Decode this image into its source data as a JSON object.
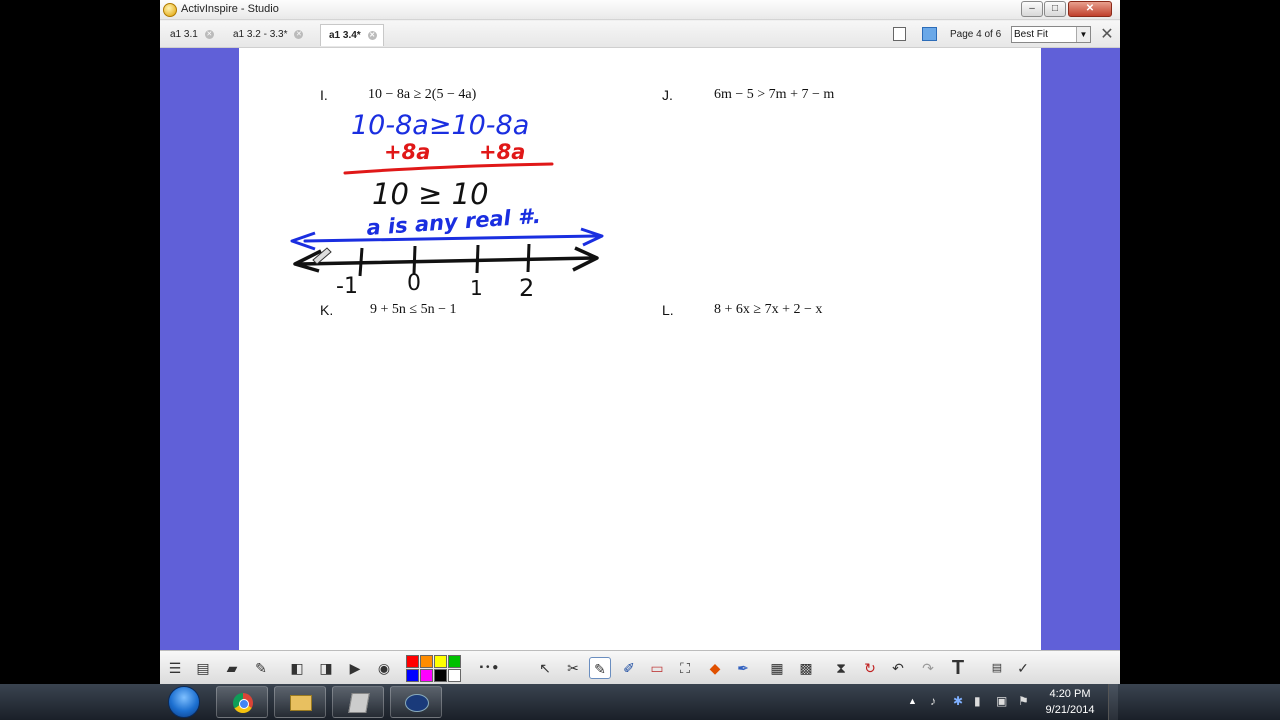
{
  "window": {
    "title": "ActivInspire - Studio",
    "minimize": "–",
    "maximize": "□",
    "close": "✕"
  },
  "tabs": [
    {
      "label": "a1 3.1"
    },
    {
      "label": "a1 3.2 - 3.3*"
    },
    {
      "label": "a1 3.4*",
      "active": true
    }
  ],
  "page_indicator": "Page 4 of 6",
  "zoom": "Best Fit",
  "flipchart": {
    "problems": [
      {
        "label": "I.",
        "expression": "10 − 8a ≥ 2(5 − 4a)"
      },
      {
        "label": "J.",
        "expression": "6m − 5 > 7m + 7 − m"
      },
      {
        "label": "K.",
        "expression": "9 + 5n ≤ 5n − 1"
      },
      {
        "label": "L.",
        "expression": "8 + 6x ≥ 7x + 2 − x"
      }
    ],
    "handwriting": {
      "line1": "10-8a≥10-8a",
      "line2a": "+8a",
      "line2b": "+8a",
      "line3": "10 ≥ 10",
      "line4": "a is any real #.",
      "ticks": [
        "-1",
        "0",
        "1",
        "2"
      ],
      "colors": {
        "blue": "#1a2ee0",
        "red": "#e01818",
        "black": "#111111"
      }
    }
  },
  "toolbar": {
    "colors": [
      "#ff0000",
      "#ff8c00",
      "#ffff00",
      "#00c000",
      "#0000ff",
      "#ff00ff",
      "#000000",
      "#ffffff"
    ],
    "text_tool": "T"
  },
  "taskbar": {
    "time": "4:20 PM",
    "date": "9/21/2014"
  }
}
